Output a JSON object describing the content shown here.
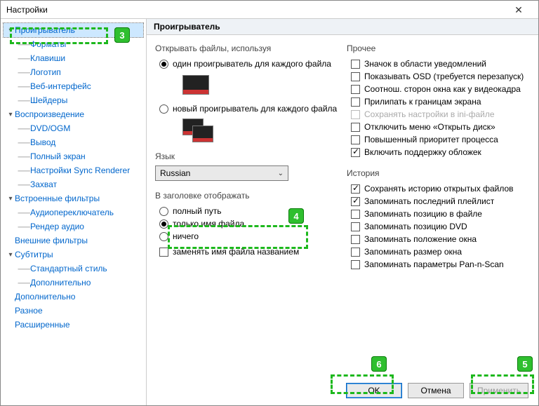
{
  "window": {
    "title": "Настройки",
    "close": "✕"
  },
  "header": {
    "section": "Проигрыватель"
  },
  "sidebar": {
    "root": [
      {
        "label": "Проигрыватель",
        "selected": true,
        "children": [
          {
            "label": "Форматы"
          },
          {
            "label": "Клавиши"
          },
          {
            "label": "Логотип"
          },
          {
            "label": "Веб-интерфейс"
          },
          {
            "label": "Шейдеры"
          }
        ]
      },
      {
        "label": "Воспроизведение",
        "expanded": true,
        "children": [
          {
            "label": "DVD/OGM"
          },
          {
            "label": "Вывод"
          },
          {
            "label": "Полный экран"
          },
          {
            "label": "Настройки Sync Renderer"
          },
          {
            "label": "Захват"
          }
        ]
      },
      {
        "label": "Встроенные фильтры",
        "expanded": true,
        "children": [
          {
            "label": "Аудиопереключатель"
          },
          {
            "label": "Рендер аудио"
          }
        ]
      },
      {
        "label": "Внешние фильтры"
      },
      {
        "label": "Субтитры",
        "expanded": true,
        "children": [
          {
            "label": "Стандартный стиль"
          },
          {
            "label": "Дополнительно"
          }
        ]
      },
      {
        "label": "Дополнительно"
      },
      {
        "label": "Разное"
      },
      {
        "label": "Расширенные"
      }
    ]
  },
  "open_files": {
    "group": "Открывать файлы, используя",
    "opt1": "один проигрыватель для каждого файла",
    "opt2": "новый проигрыватель для каждого файла",
    "selected": 0
  },
  "language": {
    "group": "Язык",
    "value": "Russian"
  },
  "title_display": {
    "group": "В заголовке отображать",
    "opt1": "полный путь",
    "opt2": "только имя файла",
    "opt3": "ничего",
    "selected": 1,
    "replace": "заменять имя файла названием",
    "replace_checked": false
  },
  "misc": {
    "group": "Прочее",
    "items": [
      {
        "label": "Значок в области уведомлений",
        "checked": false
      },
      {
        "label": "Показывать OSD (требуется перезапуск)",
        "checked": false
      },
      {
        "label": "Соотнош. сторон окна как у видеокадра",
        "checked": false
      },
      {
        "label": "Прилипать к границам экрана",
        "checked": false
      },
      {
        "label": "Сохранять настройки в ini-файле",
        "checked": false,
        "disabled": true
      },
      {
        "label": "Отключить меню «Открыть диск»",
        "checked": false
      },
      {
        "label": "Повышенный приоритет процесса",
        "checked": false
      },
      {
        "label": "Включить поддержку обложек",
        "checked": true
      }
    ]
  },
  "history": {
    "group": "История",
    "items": [
      {
        "label": "Сохранять историю открытых файлов",
        "checked": true
      },
      {
        "label": "Запоминать последний плейлист",
        "checked": true
      },
      {
        "label": "Запоминать позицию в файле",
        "checked": false
      },
      {
        "label": "Запоминать позицию DVD",
        "checked": false
      },
      {
        "label": "Запоминать положение окна",
        "checked": false
      },
      {
        "label": "Запоминать размер окна",
        "checked": false
      },
      {
        "label": "Запоминать параметры Pan-n-Scan",
        "checked": false
      }
    ]
  },
  "buttons": {
    "ok": "OK",
    "cancel": "Отмена",
    "apply": "Применить"
  },
  "annotations": {
    "n3": "3",
    "n4": "4",
    "n5": "5",
    "n6": "6"
  }
}
